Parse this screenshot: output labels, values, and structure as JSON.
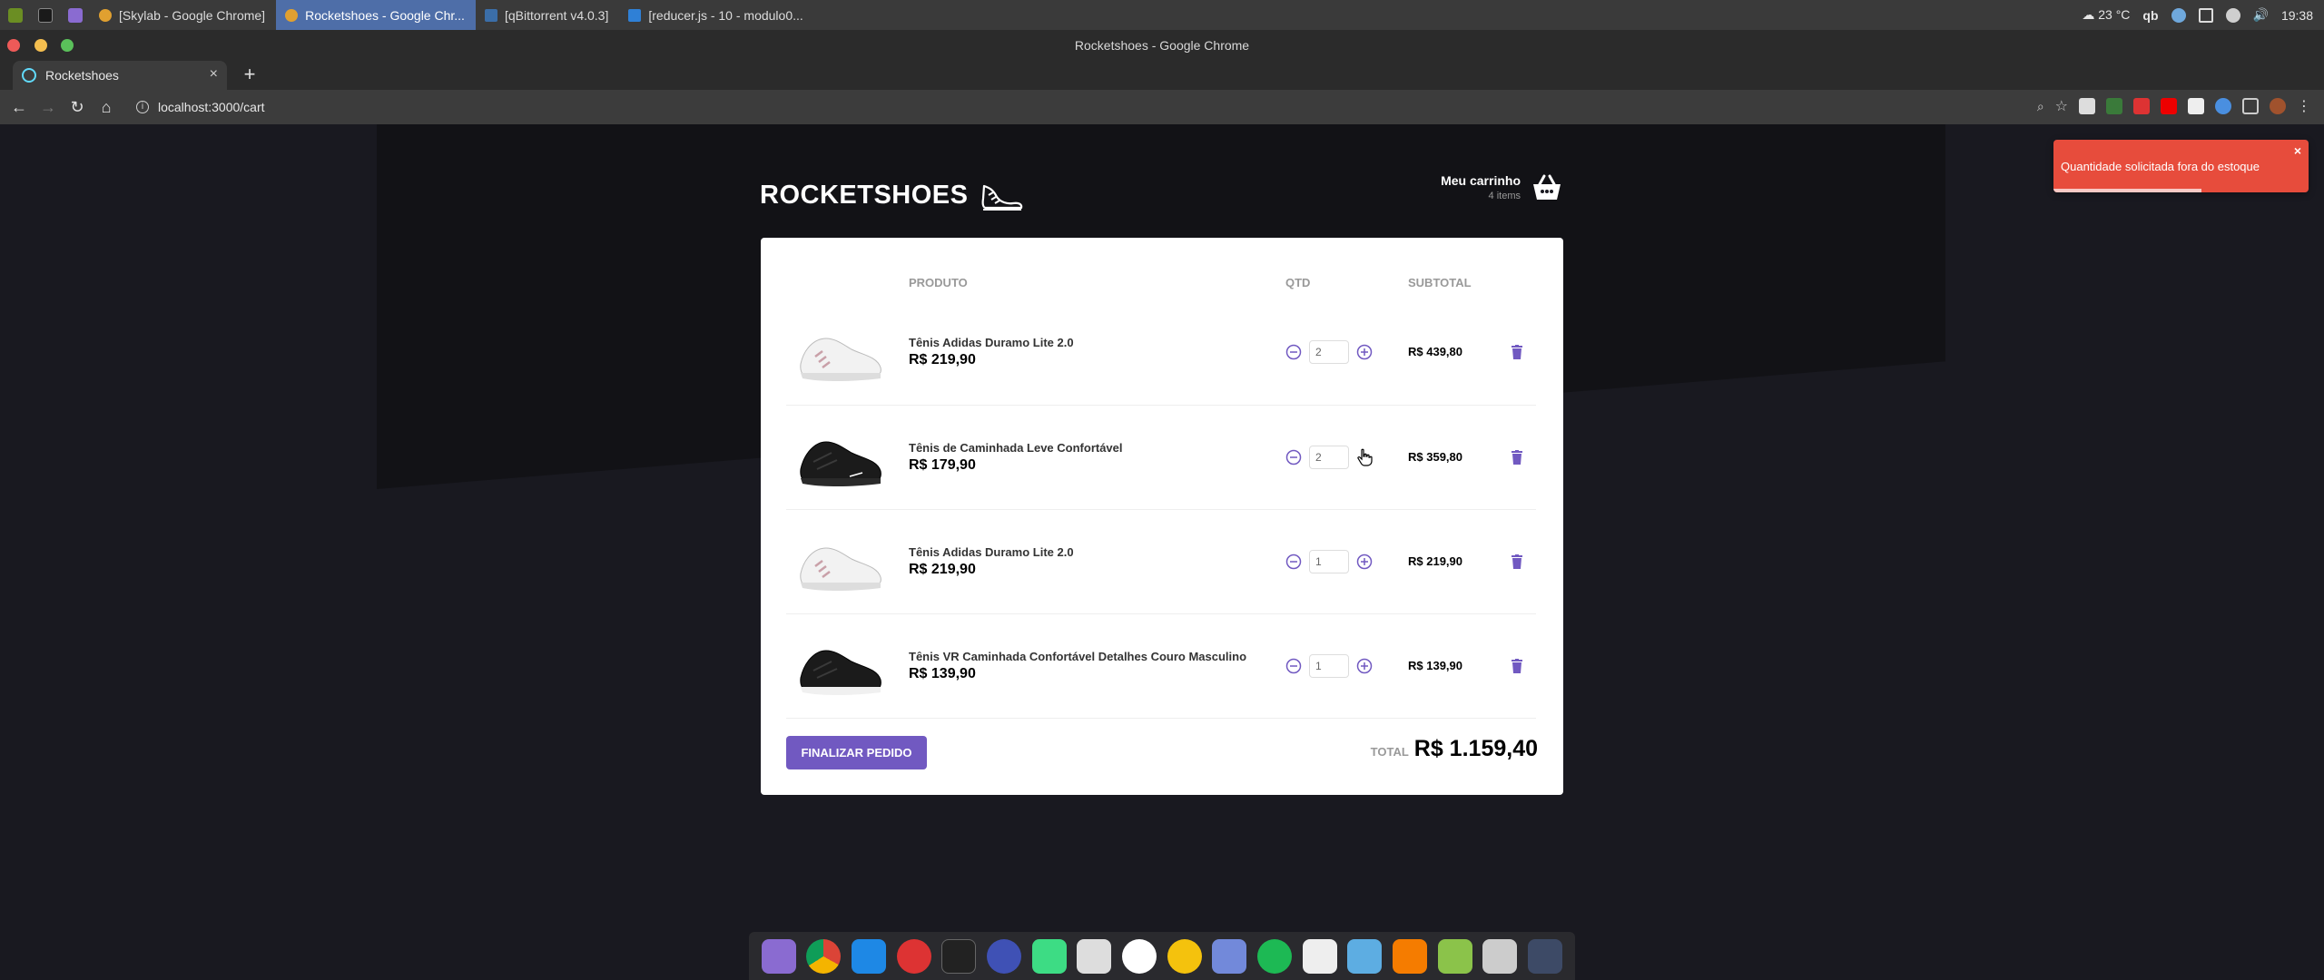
{
  "os_panel": {
    "tasks": [
      {
        "label": "[Skylab - Google Chrome]",
        "active": false
      },
      {
        "label": "Rocketshoes - Google Chr...",
        "active": true
      },
      {
        "label": "[qBittorrent v4.0.3]",
        "active": false
      },
      {
        "label": "[reducer.js - 10 - modulo0...",
        "active": false
      }
    ],
    "temperature": "23 °C",
    "qb": "qb",
    "clock": "19:38"
  },
  "browser": {
    "window_title": "Rocketshoes - Google Chrome",
    "tab_title": "Rocketshoes",
    "url": "localhost:3000/cart"
  },
  "header": {
    "logo_text": "ROCKETSHOES",
    "cart_title": "Meu carrinho",
    "cart_count": "4 items"
  },
  "table": {
    "col_product": "PRODUTO",
    "col_qty": "QTD",
    "col_subtotal": "SUBTOTAL"
  },
  "items": [
    {
      "name": "Tênis Adidas Duramo Lite 2.0",
      "price": "R$ 219,90",
      "qty": "2",
      "subtotal": "R$ 439,80",
      "color": "white"
    },
    {
      "name": "Tênis de Caminhada Leve Confortável",
      "price": "R$ 179,90",
      "qty": "2",
      "subtotal": "R$ 359,80",
      "color": "black"
    },
    {
      "name": "Tênis Adidas Duramo Lite 2.0",
      "price": "R$ 219,90",
      "qty": "1",
      "subtotal": "R$ 219,90",
      "color": "white"
    },
    {
      "name": "Tênis VR Caminhada Confortável Detalhes Couro Masculino",
      "price": "R$ 139,90",
      "qty": "1",
      "subtotal": "R$ 139,90",
      "color": "black"
    }
  ],
  "footer": {
    "checkout_label": "Finalizar pedido",
    "total_label": "TOTAL",
    "total_value": "R$ 1.159,40"
  },
  "toast": {
    "message": "Quantidade solicitada fora do estoque",
    "close": "×",
    "progress": 0.58
  },
  "colors": {
    "accent": "#7159c1",
    "background": "#191920",
    "toast": "#e74c3c"
  }
}
